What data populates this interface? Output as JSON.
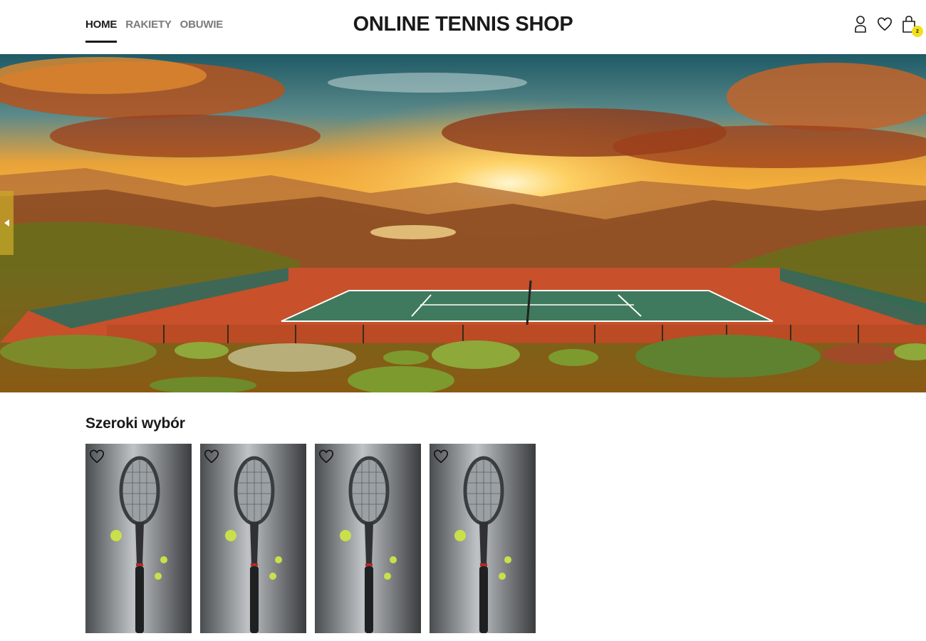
{
  "nav": {
    "items": [
      {
        "label": "HOME",
        "active": true
      },
      {
        "label": "RAKIETY",
        "active": false
      },
      {
        "label": "OBUWIE",
        "active": false
      }
    ]
  },
  "brand": {
    "title": "ONLINE TENNIS SHOP"
  },
  "header_icons": {
    "account": "user-icon",
    "wishlist": "heart-icon",
    "cart": "shopping-bag-icon",
    "cart_count": "2"
  },
  "hero": {
    "image": "sunset-tennis-court-illustration",
    "prev_control": "arrow-left-icon"
  },
  "section": {
    "title": "Szeroki wybór"
  },
  "products": [
    {
      "image": "tennis-racket-with-balls",
      "wishlist_icon": "heart-outline-icon"
    },
    {
      "image": "tennis-racket-with-balls",
      "wishlist_icon": "heart-outline-icon"
    },
    {
      "image": "tennis-racket-with-balls",
      "wishlist_icon": "heart-outline-icon"
    },
    {
      "image": "tennis-racket-with-balls",
      "wishlist_icon": "heart-outline-icon"
    }
  ],
  "colors": {
    "text": "#1a1a1a",
    "nav_inactive": "#7a7a7a",
    "badge": "#f2e01d",
    "slider_control": "#c8aa28"
  }
}
